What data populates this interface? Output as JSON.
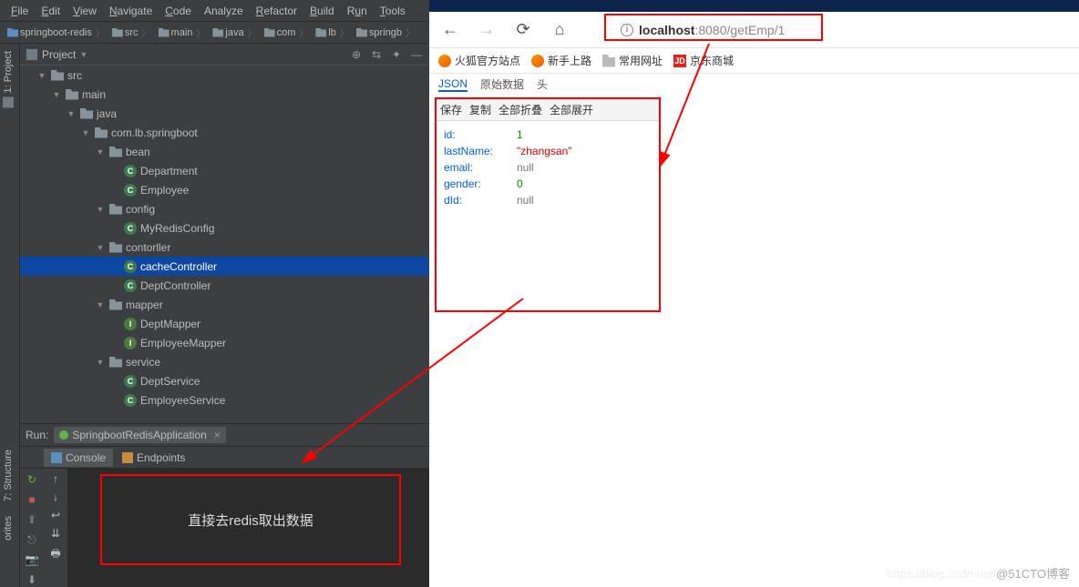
{
  "menu": {
    "file": "File",
    "edit": "Edit",
    "view": "View",
    "navigate": "Navigate",
    "code": "Code",
    "analyze": "Analyze",
    "refactor": "Refactor",
    "build": "Build",
    "run": "Run",
    "tools": "Tools"
  },
  "breadcrumbs": [
    "springboot-redis",
    "src",
    "main",
    "java",
    "com",
    "lb",
    "springb"
  ],
  "project_label": "Project",
  "sidebar_label": "1: Project",
  "sidebar_structure": "7: Structure",
  "sidebar_fav": "orites",
  "tree": [
    {
      "depth": 0,
      "type": "folder",
      "name": "src",
      "open": true
    },
    {
      "depth": 1,
      "type": "folder",
      "name": "main",
      "open": true
    },
    {
      "depth": 2,
      "type": "folder",
      "name": "java",
      "open": true
    },
    {
      "depth": 3,
      "type": "folder",
      "name": "com.lb.springboot",
      "open": true
    },
    {
      "depth": 4,
      "type": "folder",
      "name": "bean",
      "open": true
    },
    {
      "depth": 5,
      "type": "class",
      "name": "Department"
    },
    {
      "depth": 5,
      "type": "class",
      "name": "Employee"
    },
    {
      "depth": 4,
      "type": "folder",
      "name": "config",
      "open": true
    },
    {
      "depth": 5,
      "type": "class",
      "name": "MyRedisConfig"
    },
    {
      "depth": 4,
      "type": "folder",
      "name": "contorller",
      "open": true
    },
    {
      "depth": 5,
      "type": "class",
      "name": "cacheController",
      "selected": true
    },
    {
      "depth": 5,
      "type": "class",
      "name": "DeptController"
    },
    {
      "depth": 4,
      "type": "folder",
      "name": "mapper",
      "open": true
    },
    {
      "depth": 5,
      "type": "iface",
      "name": "DeptMapper"
    },
    {
      "depth": 5,
      "type": "iface",
      "name": "EmployeeMapper"
    },
    {
      "depth": 4,
      "type": "folder",
      "name": "service",
      "open": true
    },
    {
      "depth": 5,
      "type": "class",
      "name": "DeptService"
    },
    {
      "depth": 5,
      "type": "class",
      "name": "EmployeeService"
    }
  ],
  "run": {
    "label": "Run:",
    "app": "SpringbootRedisApplication",
    "tab_console": "Console",
    "tab_endpoints": "Endpoints",
    "console_text": "直接去redis取出数据"
  },
  "browser": {
    "url_host": "localhost",
    "url_rest": ":8080/getEmp/1",
    "bookmarks": {
      "ff": "火狐官方站点",
      "newbie": "新手上路",
      "common": "常用网址",
      "jd": "京东商城",
      "jd_badge": "JD"
    },
    "json_tabs": {
      "json": "JSON",
      "raw": "原始数据",
      "head": "头"
    },
    "json_toolbar": {
      "save": "保存",
      "copy": "复制",
      "collapse": "全部折叠",
      "expand": "全部展开"
    },
    "json": {
      "id_k": "id:",
      "id_v": "1",
      "lastName_k": "lastName:",
      "lastName_v": "\"zhangsan\"",
      "email_k": "email:",
      "email_v": "null",
      "gender_k": "gender:",
      "gender_v": "0",
      "dId_k": "dId:",
      "dId_v": "null"
    }
  },
  "watermark": {
    "left": "https://blog.csdn.net/",
    "right": "@51CTO博客"
  }
}
